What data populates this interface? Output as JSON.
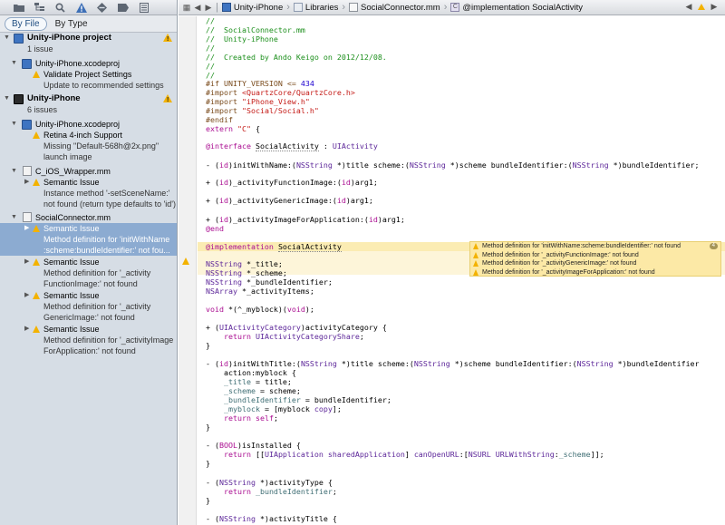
{
  "navigator": {
    "toolbar_icons": [
      "folder-icon",
      "hierarchy-icon",
      "search-icon",
      "warning-icon",
      "diamond-icon",
      "breakpoint-icon",
      "log-icon"
    ],
    "filter": {
      "by_file": "By File",
      "by_type": "By Type"
    },
    "issues": [
      {
        "kind": "project",
        "title": "Unity-iPhone project",
        "subtitle": "1 issue"
      },
      {
        "kind": "file",
        "title": "Unity-iPhone.xcodeproj"
      },
      {
        "kind": "issue",
        "title": "Validate Project Settings",
        "detail": "Update to recommended settings"
      },
      {
        "kind": "project",
        "title": "Unity-iPhone",
        "subtitle": "6 issues"
      },
      {
        "kind": "file",
        "title": "Unity-iPhone.xcodeproj"
      },
      {
        "kind": "issue",
        "title": "Retina 4-inch Support",
        "detail1": "Missing \"Default-568h@2x.png\"",
        "detail2": "launch image"
      },
      {
        "kind": "file",
        "title": "C_iOS_Wrapper.mm"
      },
      {
        "kind": "issue",
        "title": "Semantic Issue",
        "detail1": "Instance method '-setSceneName:'",
        "detail2": "not found (return type defaults to 'id')"
      },
      {
        "kind": "file",
        "title": "SocialConnector.mm"
      },
      {
        "kind": "issue",
        "title": "Semantic Issue",
        "detail1": "Method definition for 'initWithName",
        "detail2": ":scheme:bundleIdentifier:' not fou..."
      },
      {
        "kind": "issue",
        "title": "Semantic Issue",
        "detail1": "Method definition for '_activity",
        "detail2": "FunctionImage:' not found"
      },
      {
        "kind": "issue",
        "title": "Semantic Issue",
        "detail1": "Method definition for '_activity",
        "detail2": "GenericImage:' not found"
      },
      {
        "kind": "issue",
        "title": "Semantic Issue",
        "detail1": "Method definition for '_activityImage",
        "detail2": "ForApplication:' not found"
      }
    ]
  },
  "jumpbar": {
    "crumbs": [
      "Unity-iPhone",
      "Libraries",
      "SocialConnector.mm",
      "@implementation SocialActivity"
    ],
    "c_badge": "C"
  },
  "code": {
    "l01": "//",
    "l02": "//  SocialConnector.mm",
    "l03": "//  Unity-iPhone",
    "l04": "//",
    "l05": "//  Created by Ando Keigo on 2012/12/08.",
    "l06": "//",
    "l07": "//",
    "l08a": "#if UNITY_VERSION <= ",
    "l08b": "434",
    "l09a": "#import ",
    "l09b": "<QuartzCore/QuartzCore.h>",
    "l10a": "#import ",
    "l10b": "\"iPhone_View.h\"",
    "l11a": "#import ",
    "l11b": "\"Social/Social.h\"",
    "l12": "#endif",
    "l13a": "extern ",
    "l13b": "\"C\"",
    "l13c": " {",
    "l14a": "@interface",
    "l14b": "SocialActivity",
    "l14c": " : ",
    "l14d": "UIActivity",
    "l15a": "- (",
    "l15b": "id",
    "l15c": ")initWithName:(",
    "l15d": "NSString",
    "l15e": " *)title scheme:(",
    "l15f": "NSString",
    "l15g": " *)scheme bundleIdentifier:(",
    "l15h": "NSString",
    "l15i": " *)bundleIdentifier;",
    "l16a": "+ (",
    "l16b": "id",
    "l16c": ")_activityFunctionImage:(",
    "l16d": "id",
    "l16e": ")arg1;",
    "l17a": "+ (",
    "l17b": "id",
    "l17c": ")_activityGenericImage:(",
    "l17d": "id",
    "l17e": ")arg1;",
    "l18a": "+ (",
    "l18b": "id",
    "l18c": ")_activityImageForApplication:(",
    "l18d": "id",
    "l18e": ")arg1;",
    "l19": "@end",
    "l20a": "@implementation",
    "l20b": "SocialActivity",
    "l21a": "NSString",
    "l21b": " *_title;",
    "l22a": "NSString",
    "l22b": " *_scheme;",
    "l23a": "NSString",
    "l23b": " *_bundleIdentifier;",
    "l24a": "NSArray",
    "l24b": " *_activityItems;",
    "l25a": "void",
    "l25b": " *(^_myblock)(",
    "l25c": "void",
    "l25d": ");",
    "l26a": "+ (",
    "l26b": "UIActivityCategory",
    "l26c": ")activityCategory {",
    "l27a": "    return ",
    "l27b": "UIActivityCategoryShare",
    "l27c": ";",
    "l28": "}",
    "l29a": "- (",
    "l29b": "id",
    "l29c": ")initWithTitle:(",
    "l29d": "NSString",
    "l29e": " *)title scheme:(",
    "l29f": "NSString",
    "l29g": " *)scheme bundleIdentifier:(",
    "l29h": "NSString",
    "l29i": " *)bundleIdentifier",
    "l30": "    action:myblock {",
    "l31a": "    ",
    "l31b": "_title",
    "l31c": " = title;",
    "l32a": "    ",
    "l32b": "_scheme",
    "l32c": " = scheme;",
    "l33a": "    ",
    "l33b": "_bundleIdentifier",
    "l33c": " = bundleIdentifier;",
    "l34a": "    ",
    "l34b": "_myblock",
    "l34c": " = [myblock ",
    "l34d": "copy",
    "l34e": "];",
    "l35a": "    return ",
    "l35b": "self",
    "l35c": ";",
    "l36": "}",
    "l37a": "- (",
    "l37b": "BOOL",
    "l37c": ")isInstalled {",
    "l38a": "    return ",
    "l38b": "[[",
    "l38c": "UIApplication",
    "l38d": " ",
    "l38e": "sharedApplication",
    "l38f": "] ",
    "l38g": "canOpenURL",
    "l38h": ":[",
    "l38i": "NSURL",
    "l38j": " ",
    "l38k": "URLWithString",
    "l38l": ":",
    "l38m": "_scheme",
    "l38n": "]];",
    "l39": "}",
    "l40a": "- (",
    "l40b": "NSString",
    "l40c": " *)activityType {",
    "l41a": "    return ",
    "l41b": "_bundleIdentifier",
    "l41c": ";",
    "l42": "}",
    "l43a": "- (",
    "l43b": "NSString",
    "l43c": " *)activityTitle {"
  },
  "bubble": {
    "messages": [
      "Method definition for 'initWithName:scheme:bundleIdentifier:' not found",
      "Method definition for '_activityFunctionImage:' not found",
      "Method definition for '_activityGenericImage:' not found",
      "Method definition for '_activityImageForApplication:' not found"
    ],
    "count": "4"
  },
  "colors": {
    "warning": "#f3b200",
    "selection": "#8cabd1",
    "comment": "#1c8f1c",
    "keyword": "#aa0d91",
    "string": "#c41a16",
    "type": "#5c2699"
  }
}
